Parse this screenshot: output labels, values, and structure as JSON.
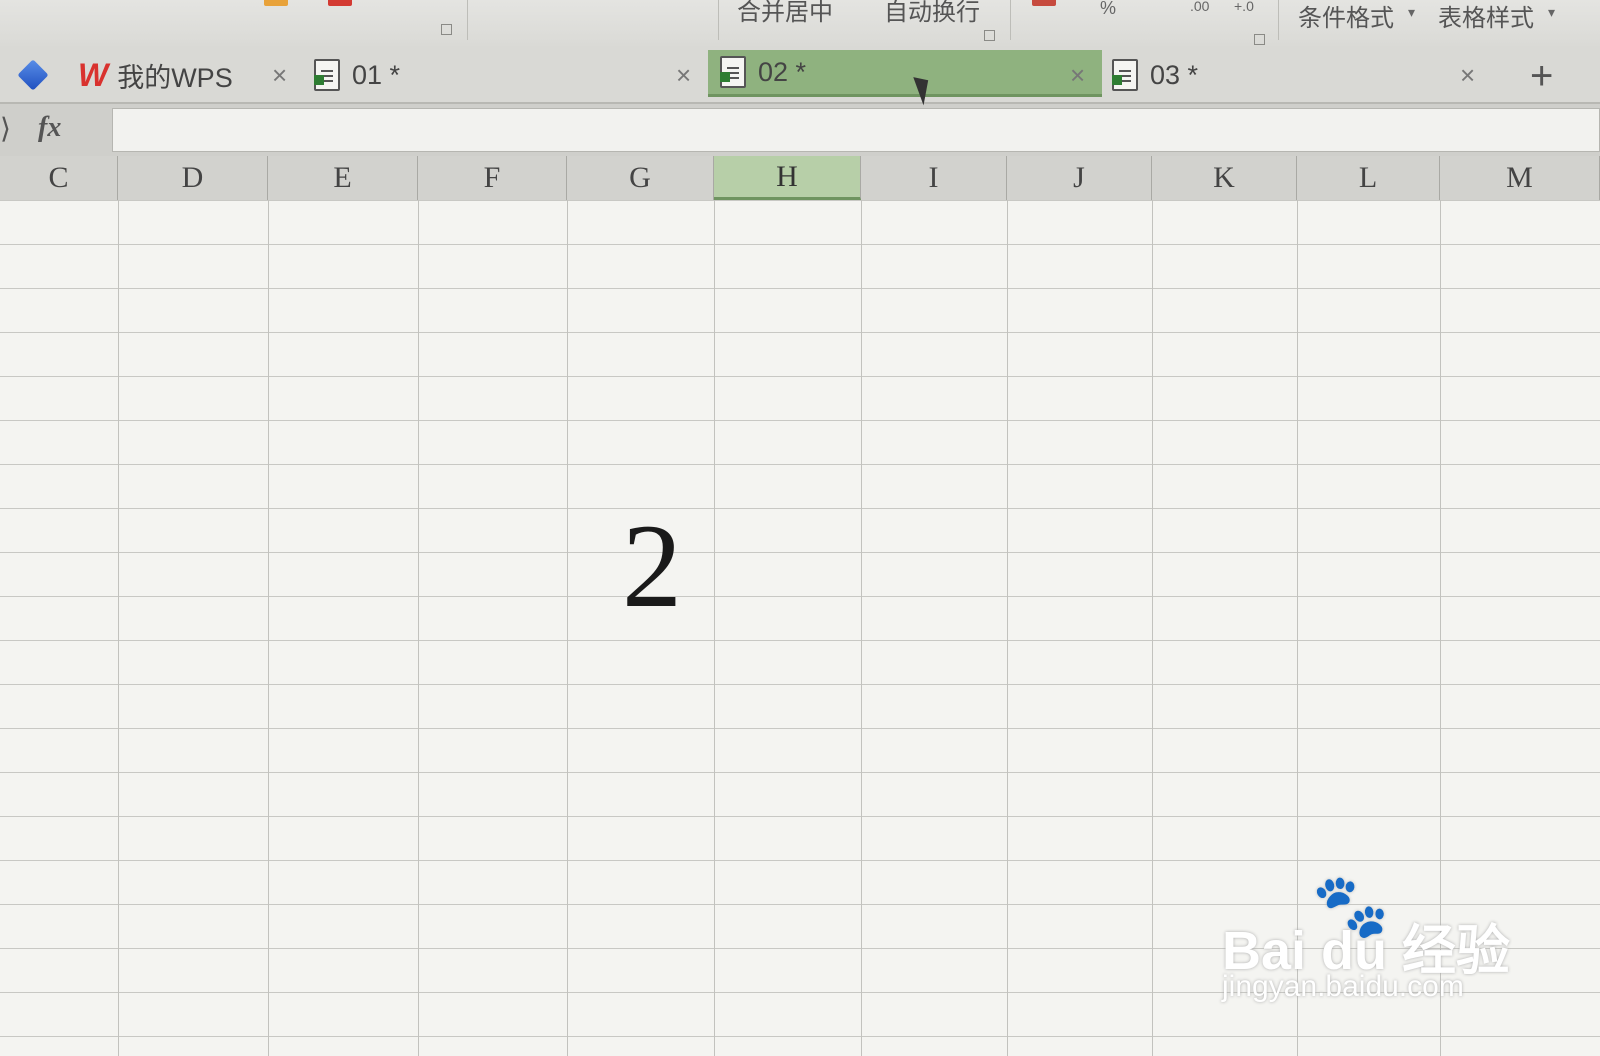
{
  "ribbon": {
    "merge_center": "合并居中",
    "wrap_text": "自动换行",
    "percent": "%",
    "decimal_increase": ".00",
    "decimal_decrease": "+.0",
    "conditional_format": "条件格式",
    "table_style": "表格样式",
    "dropdown_glyph": "▾"
  },
  "tabs": [
    {
      "label": "我的WPS",
      "type": "home"
    },
    {
      "label": "01 *",
      "type": "sheet"
    },
    {
      "label": "02 *",
      "type": "sheet",
      "active": true
    },
    {
      "label": "03 *",
      "type": "sheet"
    }
  ],
  "tab_close_glyph": "×",
  "add_tab_glyph": "+",
  "formula_bar": {
    "fx_label": "fx",
    "value": ""
  },
  "columns": [
    "C",
    "D",
    "E",
    "F",
    "G",
    "H",
    "I",
    "J",
    "K",
    "L",
    "M"
  ],
  "selected_column": "H",
  "cell": {
    "value": "2"
  },
  "watermark": {
    "brand": "Bai du 经验",
    "url": "jingyan.baidu.com"
  },
  "colors": {
    "active_tab": "#8fb27f",
    "selected_header": "#b7cfa8",
    "wps_red": "#d9322e"
  }
}
